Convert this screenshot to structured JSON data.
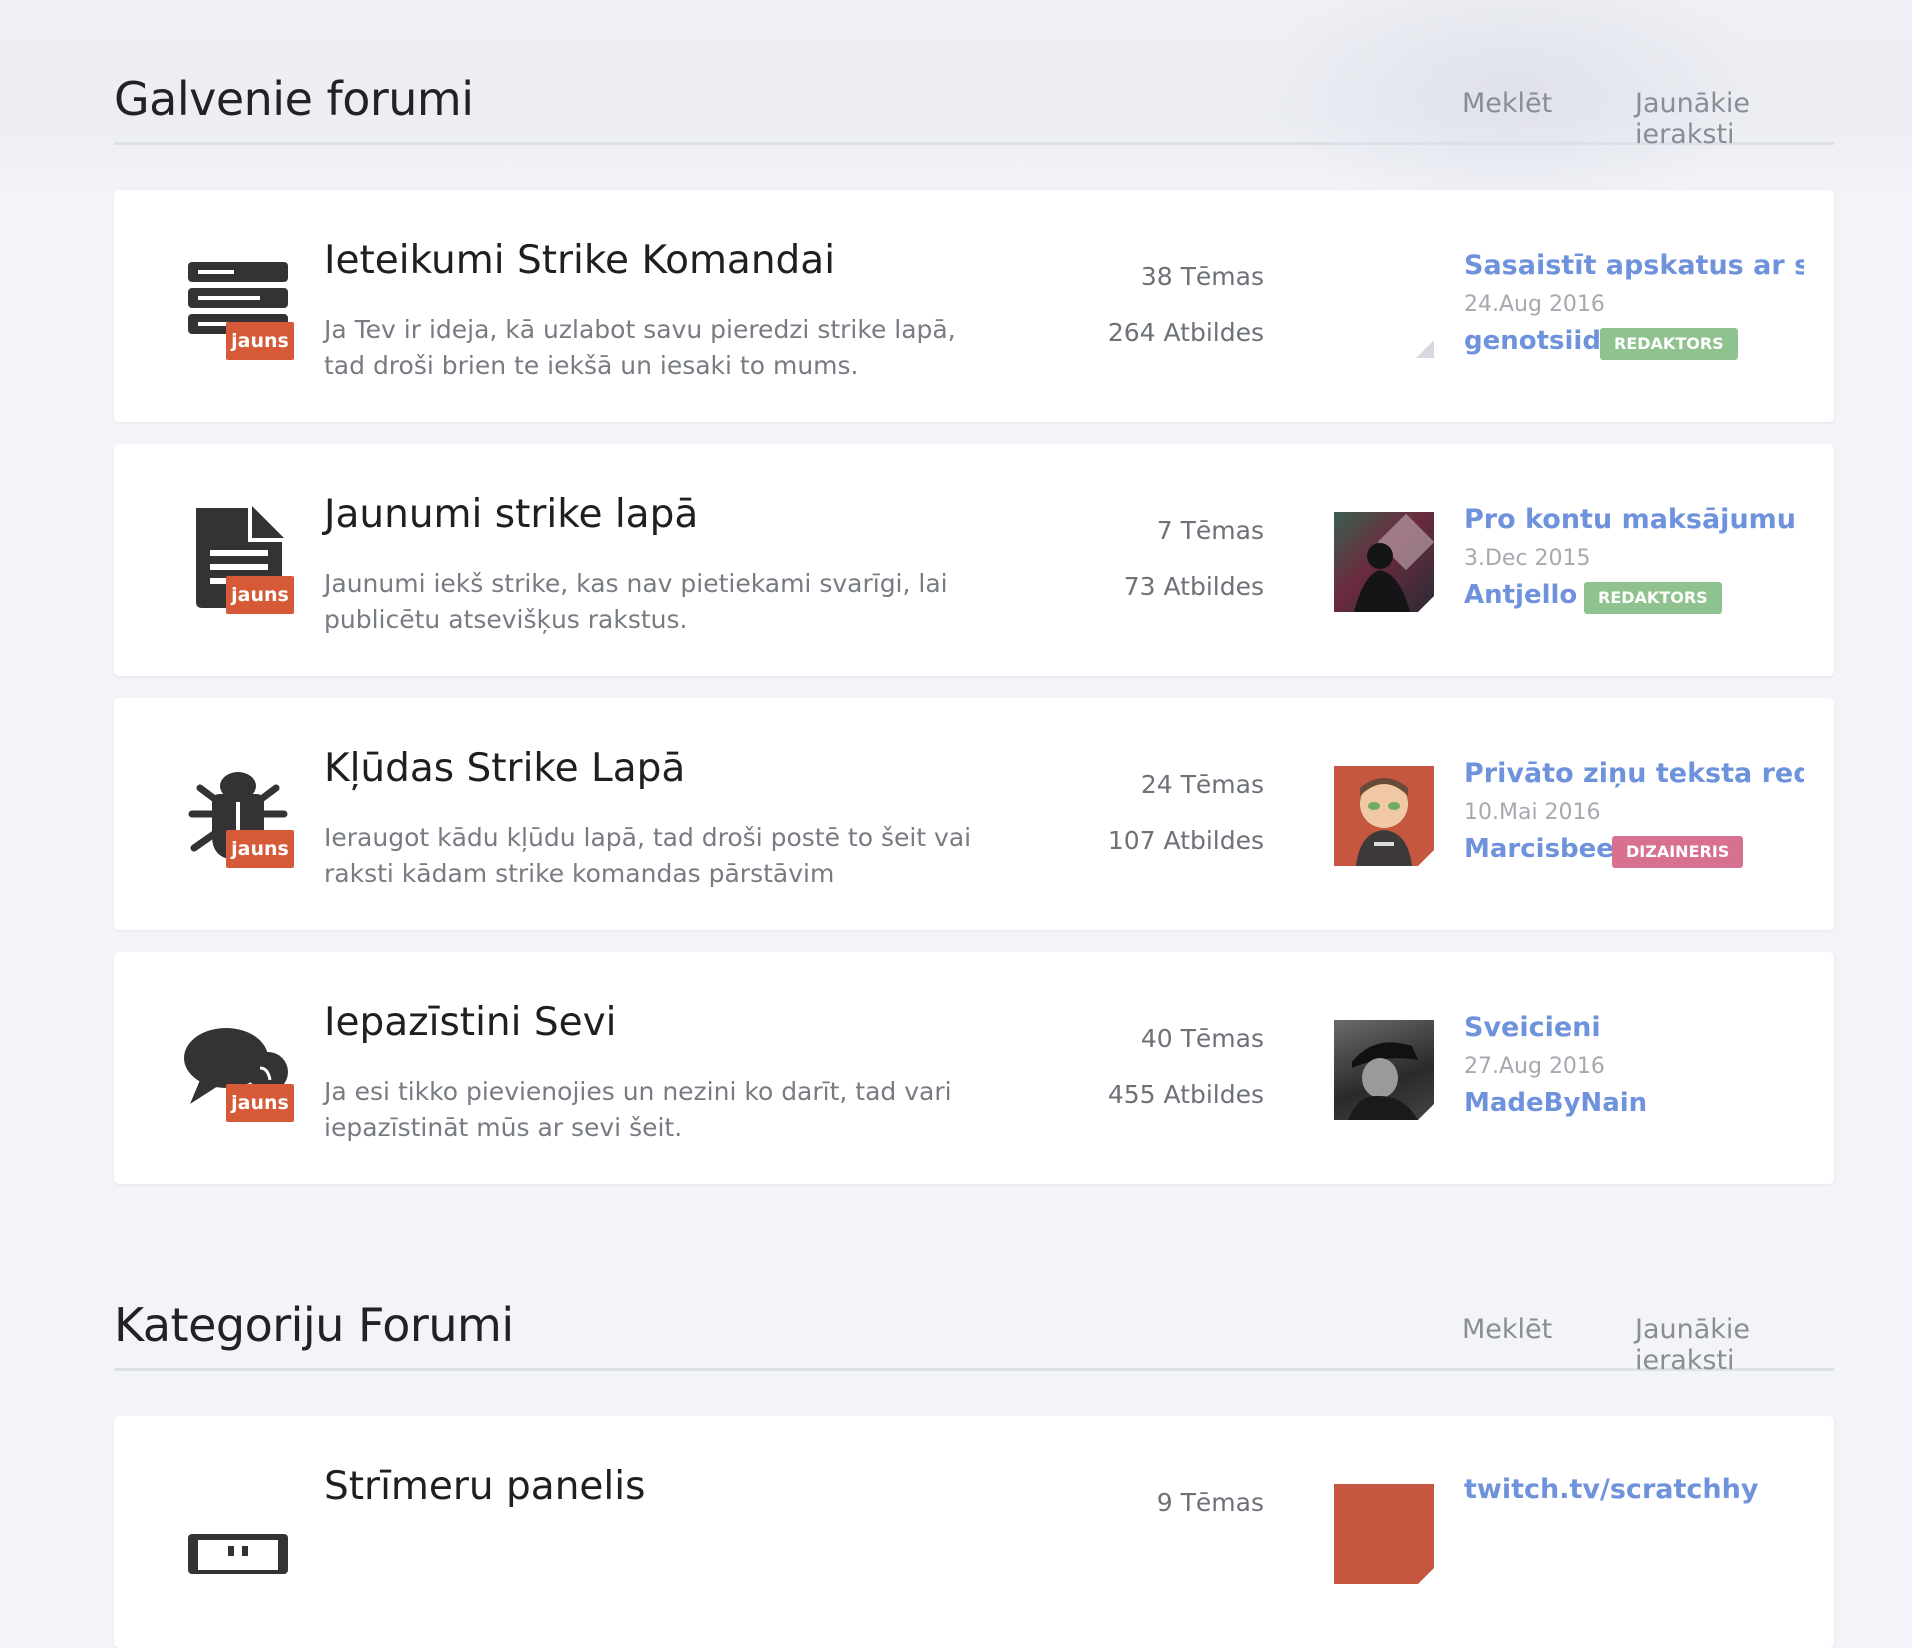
{
  "sections": [
    {
      "title": "Galvenie forumi",
      "search_label": "Meklēt",
      "latest_label": "Jaunākie ieraksti"
    },
    {
      "title": "Kategoriju Forumi",
      "search_label": "Meklēt",
      "latest_label": "Jaunākie ieraksti"
    }
  ],
  "forums": [
    {
      "icon": "server-icon",
      "new_badge": "jauns",
      "title": "Ieteikumi Strike Komandai",
      "description": "Ja Tev ir ideja, kā uzlabot savu pieredzi strike lapā, tad droši brien te iekšā un iesaki to mums.",
      "topics": "38 Tēmas",
      "replies": "264 Atbildes",
      "last_post_title": "Sasaistīt apskatus ar s...",
      "last_post_date": "24.Aug 2016",
      "last_post_user": "genotsiid",
      "role": "REDAKTORS"
    },
    {
      "icon": "document-icon",
      "new_badge": "jauns",
      "title": "Jaunumi strike lapā",
      "description": "Jaunumi iekš strike, kas nav pietiekami svarīgi, lai publicētu atsevišķus rakstus.",
      "topics": "7 Tēmas",
      "replies": "73 Atbildes",
      "last_post_title": "Pro kontu maksājumu ...",
      "last_post_date": "3.Dec 2015",
      "last_post_user": "Antjello",
      "role": "REDAKTORS"
    },
    {
      "icon": "bug-icon",
      "new_badge": "jauns",
      "title": "Kļūdas Strike Lapā",
      "description": "Ieraugot kādu kļūdu lapā, tad droši postē to šeit vai raksti kādam strike komandas pārstāvim",
      "topics": "24 Tēmas",
      "replies": "107 Atbildes",
      "last_post_title": "Privāto ziņu teksta red...",
      "last_post_date": "10.Mai 2016",
      "last_post_user": "Marcisbee",
      "role": "DIZAINERIS"
    },
    {
      "icon": "chat-bubbles-icon",
      "new_badge": "jauns",
      "title": "Iepazīstini Sevi",
      "description": "Ja esi tikko pievienojies un nezini ko darīt, tad vari iepazīstināt mūs ar sevi šeit.",
      "topics": "40 Tēmas",
      "replies": "455 Atbildes",
      "last_post_title": "Sveicieni",
      "last_post_date": "27.Aug 2016",
      "last_post_user": "MadeByNain",
      "role": ""
    },
    {
      "icon": "monitor-icon",
      "title": "Strīmeru panelis",
      "topics": "9 Tēmas",
      "last_post_title": "twitch.tv/scratchhy"
    }
  ],
  "colors": {
    "new_badge": "#d65a37",
    "link": "#6f92dc",
    "role_editor": "#8fc28f",
    "role_designer": "#d8708f"
  }
}
